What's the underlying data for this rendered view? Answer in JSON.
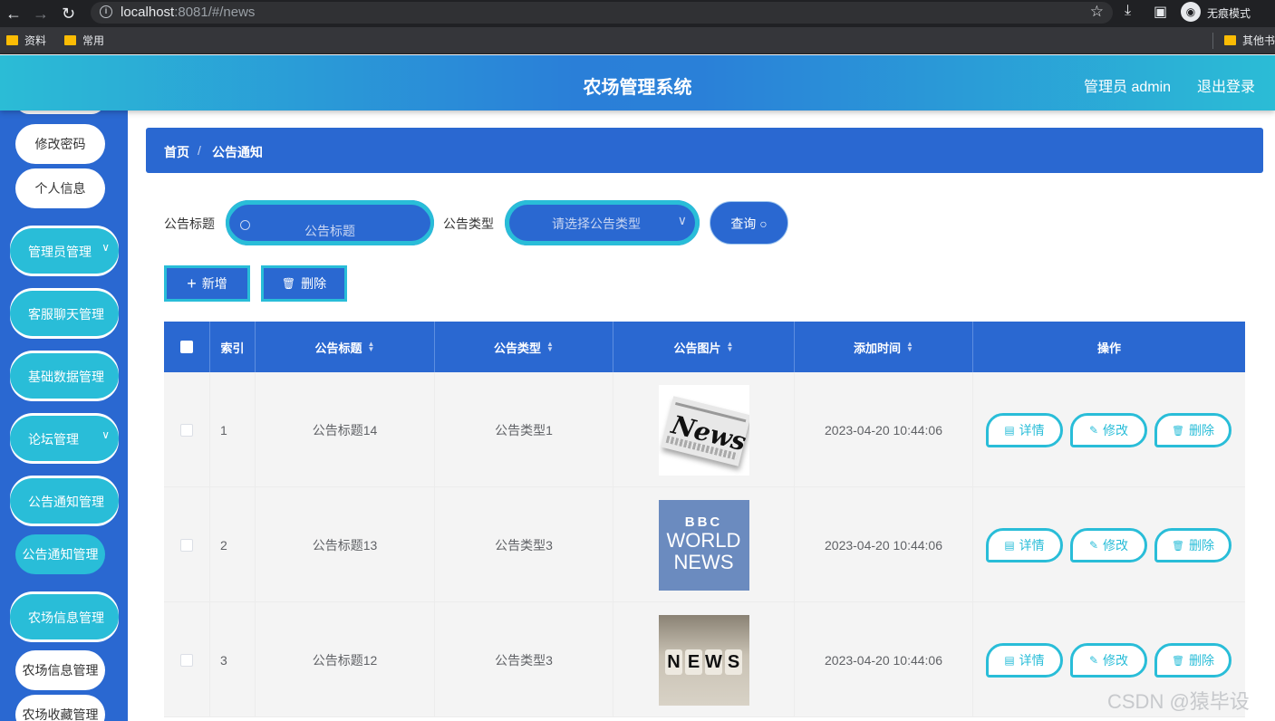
{
  "browser": {
    "url_host": "localhost",
    "url_rest": ":8081/#/news",
    "incognito_label": "无痕模式",
    "bookmarks": [
      "资料",
      "常用"
    ],
    "bookmarks_right": "其他书"
  },
  "header": {
    "title": "农场管理系统",
    "user_label": "管理员 admin",
    "logout_label": "退出登录"
  },
  "sidebar": {
    "top_items": [
      "修改密码",
      "个人信息"
    ],
    "menus": [
      {
        "label": "管理员管理",
        "chevron": "chevron-down-icon"
      },
      {
        "label": "客服聊天管理",
        "chevron": "chevron-down-icon"
      },
      {
        "label": "基础数据管理",
        "chevron": "chevron-down-icon"
      },
      {
        "label": "论坛管理",
        "chevron": "chevron-down-icon"
      },
      {
        "label": "公告通知管理",
        "chevron": "chevron-down-icon"
      },
      {
        "label": "农场信息管理",
        "chevron": "chevron-down-icon"
      }
    ],
    "sub_active": "公告通知管理",
    "sub_items": [
      "农场信息管理",
      "农场收藏管理"
    ]
  },
  "breadcrumb": {
    "home": "首页",
    "separator": "/",
    "current": "公告通知"
  },
  "search": {
    "title_label": "公告标题",
    "title_placeholder": "公告标题",
    "type_label": "公告类型",
    "type_placeholder": "请选择公告类型",
    "query_label": "查询"
  },
  "actions": {
    "add_label": "新增",
    "delete_label": "删除"
  },
  "table": {
    "headers": {
      "index": "索引",
      "title": "公告标题",
      "type": "公告类型",
      "image": "公告图片",
      "time": "添加时间",
      "ops": "操作"
    },
    "op_labels": {
      "detail": "详情",
      "edit": "修改",
      "delete": "删除"
    },
    "rows": [
      {
        "index": "1",
        "title": "公告标题14",
        "type": "公告类型1",
        "image": {
          "kind": "newspaper",
          "text": "News"
        },
        "time": "2023-04-20 10:44:06"
      },
      {
        "index": "2",
        "title": "公告标题13",
        "type": "公告类型3",
        "image": {
          "kind": "bbc",
          "text_line1": "BBC",
          "text_line2": "WORLD",
          "text_line3": "NEWS"
        },
        "time": "2023-04-20 10:44:06"
      },
      {
        "index": "3",
        "title": "公告标题12",
        "type": "公告类型3",
        "image": {
          "kind": "blocks",
          "text": "NEWS"
        },
        "time": "2023-04-20 10:44:06"
      }
    ]
  },
  "watermark": "CSDN @猿毕设"
}
